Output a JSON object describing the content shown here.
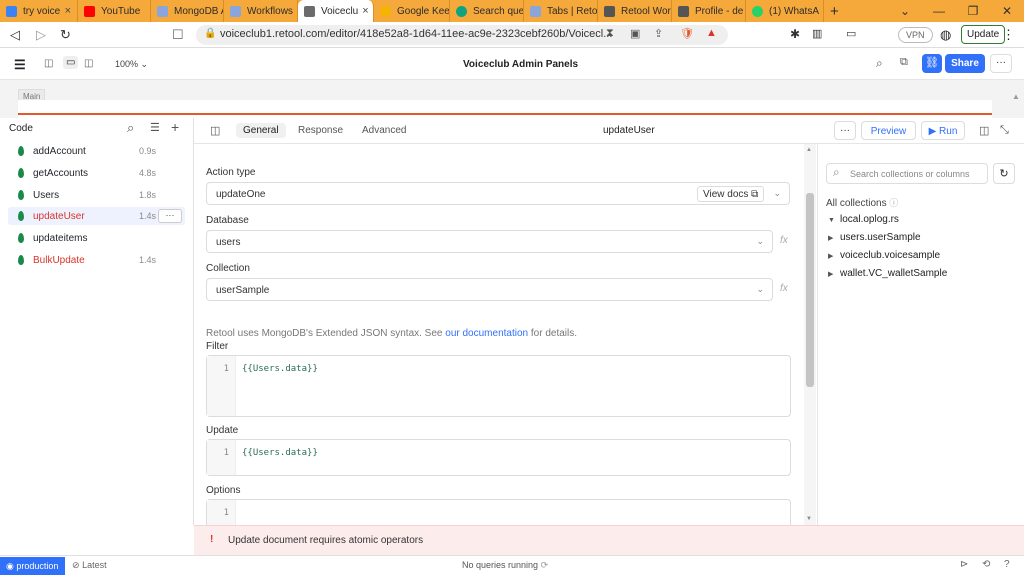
{
  "browser": {
    "tabs": [
      {
        "label": "try voice",
        "color": "#3b82f6"
      },
      {
        "label": "YouTube",
        "color": "#ff0000"
      },
      {
        "label": "MongoDB A",
        "color": "#6b8ed6"
      },
      {
        "label": "Workflows",
        "color": "#6b8ed6"
      },
      {
        "label": "Voiceclu",
        "color": "#6b8ed6"
      },
      {
        "label": "Google Kee",
        "color": "#f4b400"
      },
      {
        "label": "Search que",
        "color": "#10a37f"
      },
      {
        "label": "Tabs | Reto",
        "color": "#6b8ed6"
      },
      {
        "label": "Retool Wor",
        "color": "#444444"
      },
      {
        "label": "Profile - de",
        "color": "#444444"
      },
      {
        "label": "(1) WhatsA",
        "color": "#25d366"
      }
    ],
    "url": "voiceclub1.retool.com/editor/418e52a8-1d64-11ee-ac9e-2323cebf260b/Voicecl...",
    "vpn_label": "VPN",
    "update_label": "Update"
  },
  "header": {
    "zoom": "100%",
    "title": "Voiceclub Admin Panels",
    "share_label": "Share"
  },
  "canvas": {
    "page_label": "Main"
  },
  "code_panel": {
    "title": "Code",
    "queries": [
      {
        "name": "addAccount",
        "duration": "0.9s",
        "error": false
      },
      {
        "name": "getAccounts",
        "duration": "4.8s",
        "error": false
      },
      {
        "name": "Users",
        "duration": "1.8s",
        "error": false
      },
      {
        "name": "updateUser",
        "duration": "1.4s",
        "error": true
      },
      {
        "name": "updateitems",
        "duration": "",
        "error": false
      },
      {
        "name": "BulkUpdate",
        "duration": "1.4s",
        "error": true
      }
    ]
  },
  "editor": {
    "tabs": [
      "General",
      "Response",
      "Advanced"
    ],
    "query_name": "updateUser",
    "preview_label": "Preview",
    "run_label": "Run",
    "action_type_label": "Action type",
    "action_type_value": "updateOne",
    "view_docs_label": "View docs",
    "database_label": "Database",
    "database_value": "users",
    "collection_label": "Collection",
    "collection_value": "userSample",
    "ejson_note_prefix": "Retool uses MongoDB's Extended JSON syntax. See ",
    "ejson_note_link": "our documentation",
    "ejson_note_suffix": " for details.",
    "filter_label": "Filter",
    "filter_code": "{{Users.data}}",
    "update_label": "Update",
    "update_code": "{{Users.data}}",
    "options_label": "Options",
    "line_number": "1"
  },
  "collections_panel": {
    "search_placeholder": "Search collections or columns",
    "heading": "All collections",
    "items": [
      {
        "name": "local.oplog.rs",
        "expanded": true
      },
      {
        "name": "users.userSample",
        "expanded": false
      },
      {
        "name": "voiceclub.voicesample",
        "expanded": false
      },
      {
        "name": "wallet.VC_walletSample",
        "expanded": false
      }
    ]
  },
  "status": {
    "error_message": "Update document requires atomic operators",
    "environment": "production",
    "version": "Latest",
    "queries_running": "No queries running"
  },
  "colors": {
    "accent": "#3170f9",
    "brand_orange": "#e25a2c",
    "error_red": "#d9352b",
    "mongo_green": "#1a8a4a"
  }
}
